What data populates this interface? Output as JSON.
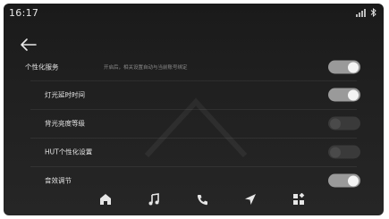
{
  "status": {
    "time": "16:17"
  },
  "nav": {
    "back_label": "←"
  },
  "settings": {
    "main": {
      "label": "个性化服务",
      "description": "开启后，相关设置自动与当前账号绑定",
      "enabled": true
    },
    "items": [
      {
        "label": "灯光延时时间",
        "enabled": true
      },
      {
        "label": "背光亮度等级",
        "enabled": false
      },
      {
        "label": "HUT个性化设置",
        "enabled": false
      },
      {
        "label": "音效调节",
        "enabled": true
      }
    ]
  },
  "dock": {
    "icons": [
      "home-icon",
      "music-icon",
      "phone-icon",
      "navigation-icon",
      "apps-icon"
    ]
  },
  "colors": {
    "background": "#1f1f1f",
    "toggle_on": "#9a9a9a",
    "toggle_off": "#3a3a3a",
    "knob_on": "#f4f4f4"
  }
}
